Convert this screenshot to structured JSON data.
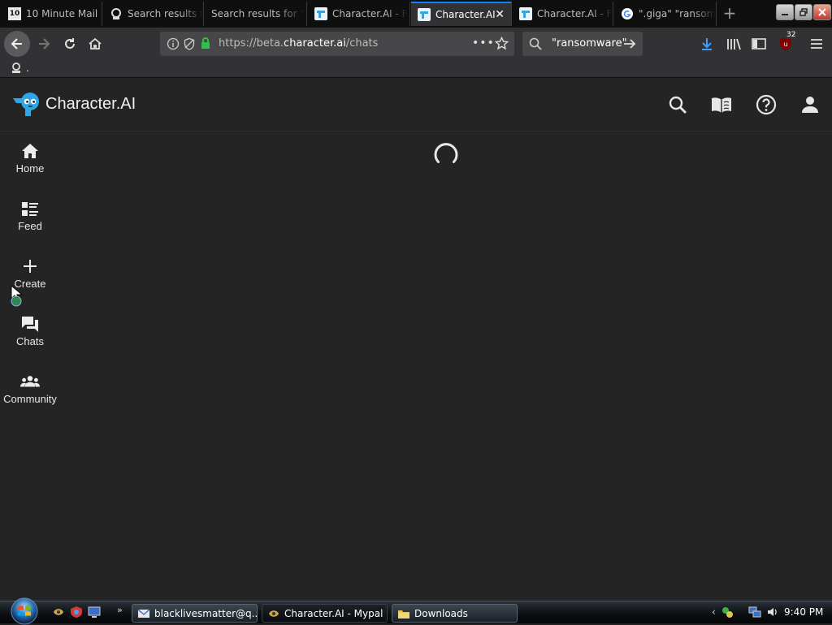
{
  "browser": {
    "tabs": [
      {
        "favicon_text": "10",
        "title": "10 Minute Mail",
        "active": false
      },
      {
        "title": "Search results f",
        "active": false
      },
      {
        "title": "Search results for \"",
        "active": false
      },
      {
        "title": "Character.AI - F",
        "active": false
      },
      {
        "title": "Character.AI",
        "active": true
      },
      {
        "title": "Character.AI - F",
        "active": false
      },
      {
        "title": "\".giga\" \"ransom",
        "active": false
      }
    ],
    "new_tab_label": "+",
    "url_prefix": "https://beta.",
    "url_domain": "character.ai",
    "url_path": "/chats",
    "search_value": "\"ransomware\"",
    "ublock_count": "32",
    "bookmark_label": "."
  },
  "app": {
    "brand_name": "Character.AI",
    "nav": [
      {
        "label": "Home",
        "icon": "home-icon"
      },
      {
        "label": "Feed",
        "icon": "feed-icon"
      },
      {
        "label": "Create",
        "icon": "plus-icon"
      },
      {
        "label": "Chats",
        "icon": "chat-icon"
      },
      {
        "label": "Community",
        "icon": "community-icon"
      }
    ],
    "header_icons": [
      "search-icon",
      "book-icon",
      "help-icon",
      "account-icon"
    ],
    "accent_color": "#2ea7e6"
  },
  "taskbar": {
    "buttons": [
      {
        "label": "blacklivesmatter@q..."
      },
      {
        "label": "Character.AI - Mypal"
      },
      {
        "label": "Downloads"
      }
    ],
    "clock": "9:40 PM"
  }
}
